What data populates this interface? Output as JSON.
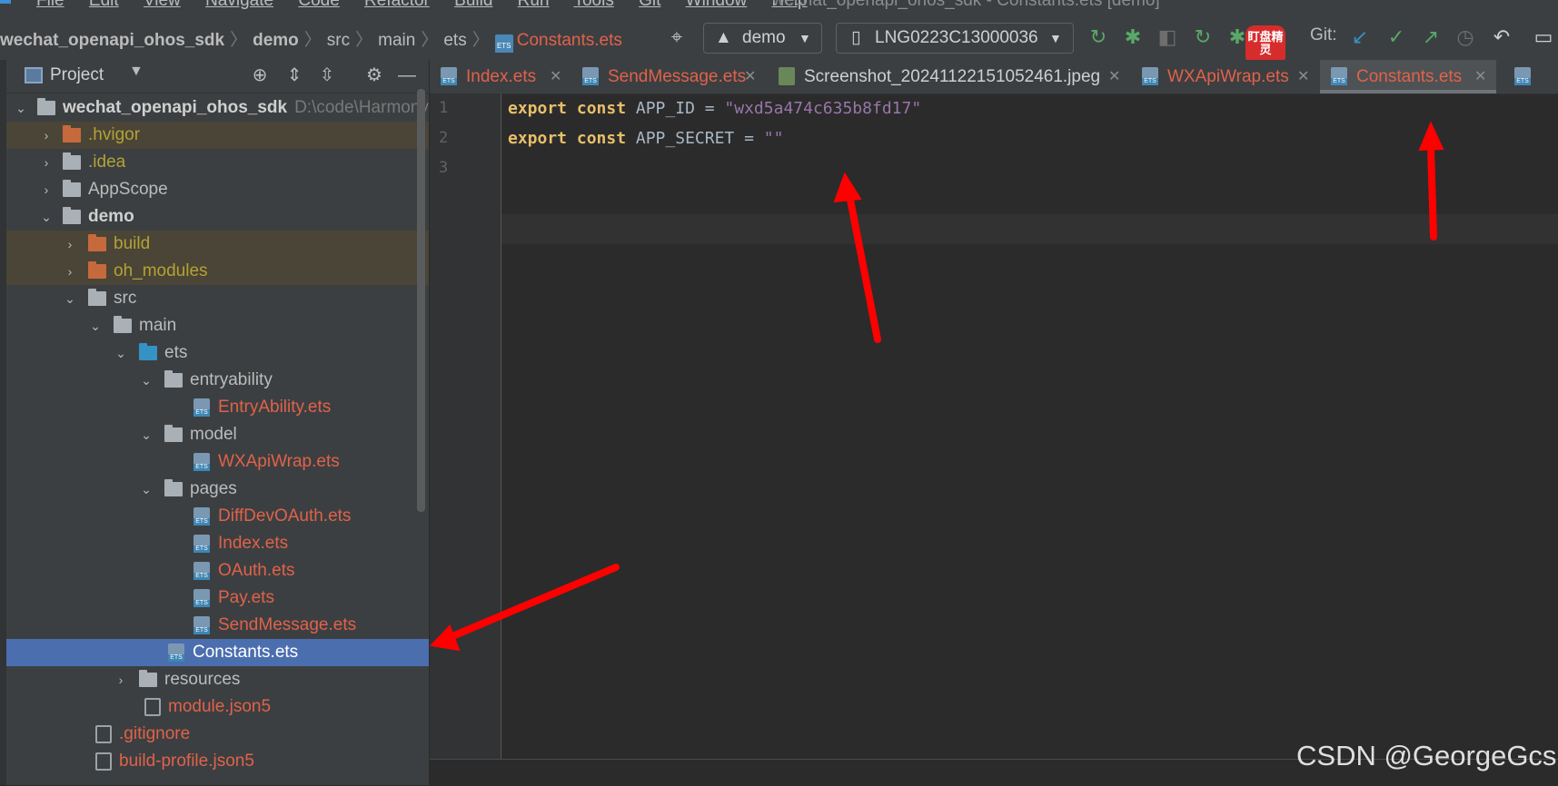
{
  "menu": {
    "items": [
      "File",
      "Edit",
      "View",
      "Navigate",
      "Code",
      "Refactor",
      "Build",
      "Run",
      "Tools",
      "Git",
      "Window",
      "Help"
    ],
    "window_title": "wechat_openapi_ohos_sdk - Constants.ets [demo]"
  },
  "breadcrumb": {
    "project": "wechat_openapi_ohos_sdk",
    "module": "demo",
    "src": "src",
    "main": "main",
    "ets": "ets",
    "file": "Constants.ets"
  },
  "toolbar": {
    "run_config": "demo",
    "device": "LNG0223C13000036",
    "git_label": "Git:",
    "badge_text": "盯盘精灵"
  },
  "sidebar": {
    "title": "Project",
    "root_name": "wechat_openapi_ohos_sdk",
    "root_path": "D:\\code\\Harmony",
    "items": [
      {
        "label": ".hvigor"
      },
      {
        "label": ".idea"
      },
      {
        "label": "AppScope"
      },
      {
        "label": "demo"
      },
      {
        "label": "build"
      },
      {
        "label": "oh_modules"
      },
      {
        "label": "src"
      },
      {
        "label": "main"
      },
      {
        "label": "ets"
      },
      {
        "label": "entryability"
      },
      {
        "label": "EntryAbility.ets"
      },
      {
        "label": "model"
      },
      {
        "label": "WXApiWrap.ets"
      },
      {
        "label": "pages"
      },
      {
        "label": "DiffDevOAuth.ets"
      },
      {
        "label": "Index.ets"
      },
      {
        "label": "OAuth.ets"
      },
      {
        "label": "Pay.ets"
      },
      {
        "label": "SendMessage.ets"
      },
      {
        "label": "Constants.ets"
      },
      {
        "label": "resources"
      },
      {
        "label": "module.json5"
      },
      {
        "label": ".gitignore"
      },
      {
        "label": "build-profile.json5"
      }
    ]
  },
  "tabs": [
    {
      "label": "Index.ets"
    },
    {
      "label": "SendMessage.ets"
    },
    {
      "label": "Screenshot_20241122151052461.jpeg"
    },
    {
      "label": "WXApiWrap.ets"
    },
    {
      "label": "Constants.ets"
    }
  ],
  "editor": {
    "line_numbers": [
      "1",
      "2",
      "3"
    ],
    "lines": [
      {
        "kw": "export const",
        "ident": " APP_ID = ",
        "str": "\"wxd5a474c635b8fd17\""
      },
      {
        "kw": "export const",
        "ident": " APP_SECRET = ",
        "str": "\"\""
      }
    ]
  },
  "watermark": "CSDN @GeorgeGcs"
}
